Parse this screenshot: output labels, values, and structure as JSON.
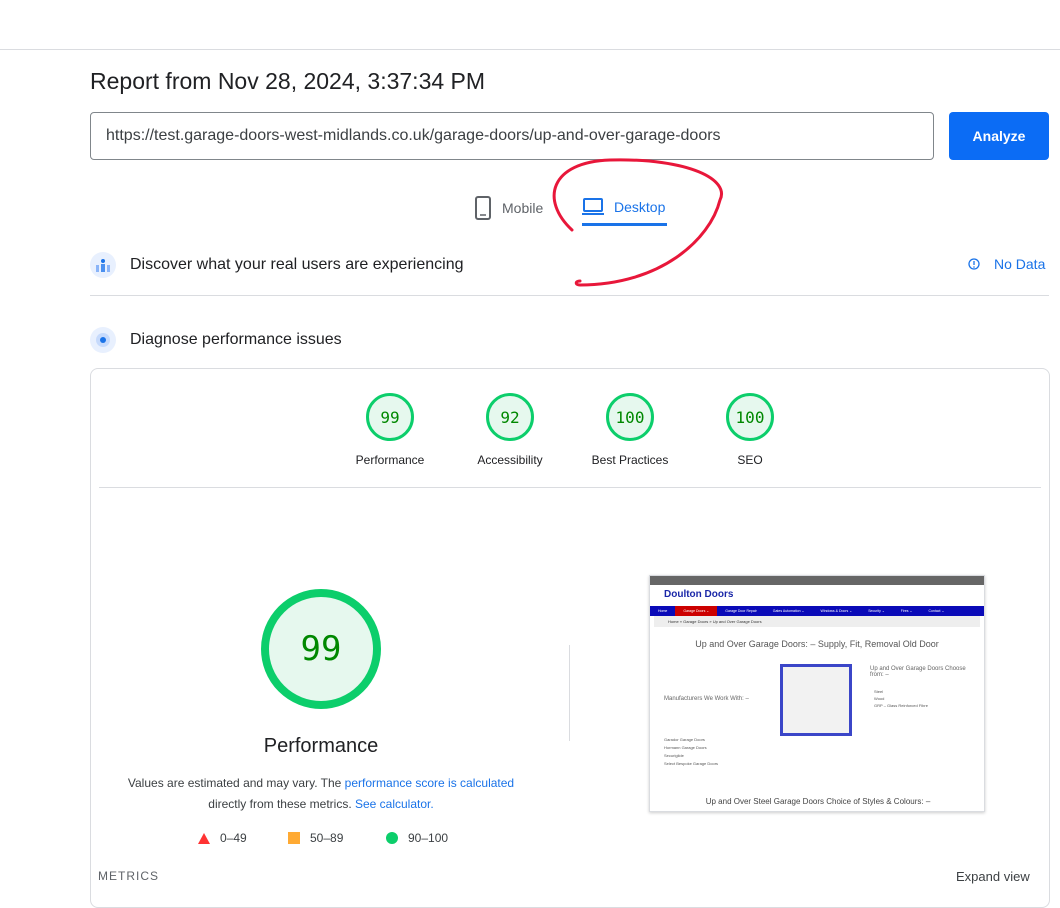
{
  "report": {
    "title": "Report from Nov 28, 2024, 3:37:34 PM",
    "url": "https://test.garage-doors-west-midlands.co.uk/garage-doors/up-and-over-garage-doors",
    "analyze_label": "Analyze"
  },
  "tabs": [
    {
      "label": "Mobile",
      "icon": "phone-icon",
      "active": false
    },
    {
      "label": "Desktop",
      "icon": "laptop-icon",
      "active": true
    }
  ],
  "field_data": {
    "title": "Discover what your real users are experiencing",
    "status": "No Data",
    "icon": "users-icon"
  },
  "lab": {
    "title": "Diagnose performance issues",
    "icon": "radar-icon"
  },
  "scores": [
    {
      "label": "Performance",
      "value": "99"
    },
    {
      "label": "Accessibility",
      "value": "92"
    },
    {
      "label": "Best Practices",
      "value": "100"
    },
    {
      "label": "SEO",
      "value": "100"
    }
  ],
  "main_score": {
    "value": "99",
    "label": "Performance",
    "note_prefix": "Values are estimated and may vary. The ",
    "note_link": "performance score is calculated",
    "note_mid": "directly from these metrics. ",
    "note_link2": "See calculator.",
    "note_suffix": ""
  },
  "legend": [
    {
      "range": "0–49",
      "color": "#ff3333",
      "shape": "triangle"
    },
    {
      "range": "50–89",
      "color": "#ffaa33",
      "shape": "square"
    },
    {
      "range": "90–100",
      "color": "#0cce6b",
      "shape": "circle"
    }
  ],
  "screenshot": {
    "logo": "Doulton Doors",
    "nav": [
      "Home",
      "Garage Doors ⌄",
      "Garage Door Repair",
      "Gates Automation ⌄",
      "Windows & Doors ⌄",
      "Security ⌄",
      "Fires ⌄",
      "Contact ⌄"
    ],
    "breadcrumb": "Home » Garage Doors » Up and Over Garage Doors",
    "heading": "Up and Over Garage Doors: – Supply, Fit, Removal Old Door",
    "side_heading": "Up and Over Garage Doors Choose from: –",
    "materials": [
      "Steel",
      "Wood",
      "GRP – Glass Reinforced Fibre"
    ],
    "manufacturers_heading": "Manufacturers We Work With: –",
    "manufacturers": [
      "Garador Garage Doors",
      "Hormann Garage Doors",
      "Securiglide",
      "Select Bespoke Garage Doors"
    ],
    "footer_heading": "Up and Over Steel Garage Doors Choice of Styles & Colours: –"
  },
  "metrics": {
    "label": "METRICS",
    "expand": "Expand view"
  },
  "colors": {
    "accent": "#1a73e8",
    "pass": "#0cce6b",
    "annotation": "#e8173a"
  }
}
